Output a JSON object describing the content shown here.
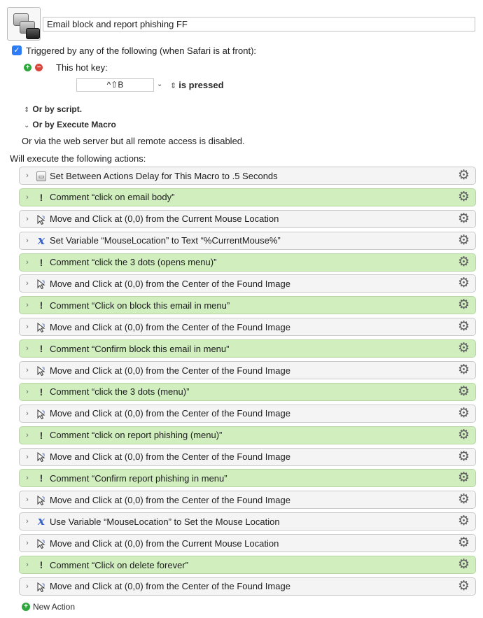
{
  "macro": {
    "name": "Email block and report phishing FF"
  },
  "trigger": {
    "checked": true,
    "label": "Triggered by any of the following (when Safari is at front):",
    "hotkey_label": "This hot key:",
    "hotkey_value": "^⇧B",
    "hotkey_state": "is pressed",
    "or_by_script": "Or by script.",
    "or_by_execute_macro": "Or by Execute Macro",
    "web_server_note": "Or via the web server but all remote access is disabled."
  },
  "actions_header": "Will execute the following actions:",
  "actions": [
    {
      "type": "delay",
      "icon": "delay-icon",
      "label": "Set Between Actions Delay for This Macro to .5 Seconds"
    },
    {
      "type": "comment",
      "icon": "exclamation-icon",
      "label": "Comment “click on email body”"
    },
    {
      "type": "click",
      "icon": "cursor-icon",
      "label": "Move and Click at (0,0) from the Current Mouse Location"
    },
    {
      "type": "variable",
      "icon": "variable-x-icon",
      "label": "Set Variable “MouseLocation” to Text “%CurrentMouse%”"
    },
    {
      "type": "comment",
      "icon": "exclamation-icon",
      "label": "Comment “click the 3 dots (opens menu)”"
    },
    {
      "type": "click",
      "icon": "cursor-icon",
      "label": "Move and Click at (0,0) from the Center of the Found Image"
    },
    {
      "type": "comment",
      "icon": "exclamation-icon",
      "label": "Comment “Click on block this email in menu”"
    },
    {
      "type": "click",
      "icon": "cursor-icon",
      "label": "Move and Click at (0,0) from the Center of the Found Image"
    },
    {
      "type": "comment",
      "icon": "exclamation-icon",
      "label": "Comment “Confirm block this email in menu”"
    },
    {
      "type": "click",
      "icon": "cursor-icon",
      "label": "Move and Click at (0,0) from the Center of the Found Image"
    },
    {
      "type": "comment",
      "icon": "exclamation-icon",
      "label": "Comment “click the 3 dots (menu)”"
    },
    {
      "type": "click",
      "icon": "cursor-icon",
      "label": "Move and Click at (0,0) from the Center of the Found Image"
    },
    {
      "type": "comment",
      "icon": "exclamation-icon",
      "label": "Comment “click on report phishing (menu)”"
    },
    {
      "type": "click",
      "icon": "cursor-icon",
      "label": "Move and Click at (0,0) from the Center of the Found Image"
    },
    {
      "type": "comment",
      "icon": "exclamation-icon",
      "label": "Comment “Confirm report phishing in menu”"
    },
    {
      "type": "click",
      "icon": "cursor-icon",
      "label": "Move and Click at (0,0) from the Center of the Found Image"
    },
    {
      "type": "variable",
      "icon": "variable-x-icon",
      "label": "Use Variable “MouseLocation” to Set the Mouse Location"
    },
    {
      "type": "click",
      "icon": "cursor-icon",
      "label": "Move and Click at (0,0) from the Current Mouse Location"
    },
    {
      "type": "comment",
      "icon": "exclamation-icon",
      "label": "Comment “Click on delete forever”"
    },
    {
      "type": "click",
      "icon": "cursor-icon",
      "label": "Move and Click at (0,0) from the Center of the Found Image"
    }
  ],
  "new_action_label": "New Action",
  "colors": {
    "comment_background": "#d1eebf",
    "action_background": "#f4f4f4",
    "checkbox_accent": "#2d7cf6",
    "add_green": "#2fa73e",
    "remove_red": "#d9463d"
  }
}
